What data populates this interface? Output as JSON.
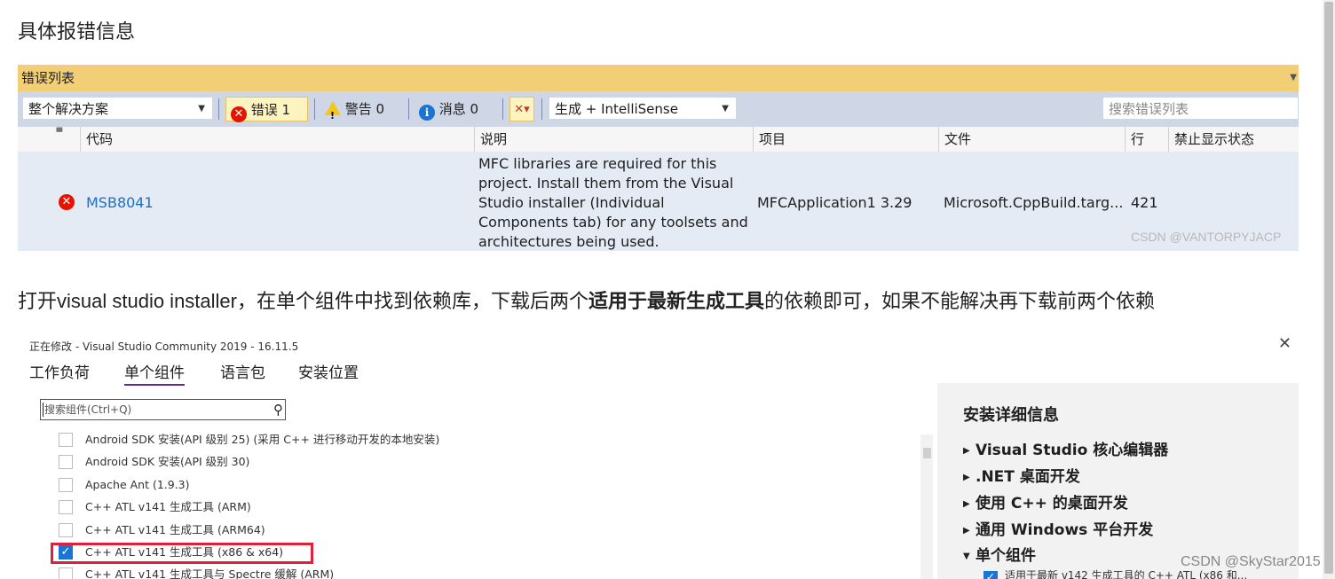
{
  "heading1": "具体报错信息",
  "error_list": {
    "title": "错误列表",
    "scope": "整个解决方案",
    "errors": "错误 1",
    "warnings": "警告 0",
    "messages": "消息 0",
    "build_filter": "生成 + IntelliSense",
    "search_placeholder": "搜索错误列表",
    "columns": [
      "代码",
      "说明",
      "项目",
      "文件",
      "行",
      "禁止显示状态"
    ],
    "row": {
      "code": "MSB8041",
      "description": [
        "MFC libraries are required for this",
        "project. Install them from the Visual",
        "Studio installer (Individual",
        "Components tab) for any toolsets and",
        "architectures being used."
      ],
      "project": "MFCApplication1 3.29",
      "file": "Microsoft.CppBuild.targ...",
      "line": "421"
    },
    "watermark": "CSDN @VANTORPYJACP"
  },
  "paragraph": {
    "pre": "打开visual studio installer，在单个组件中找到依赖库，下载后两个",
    "bold": "适用于最新生成工具",
    "post": "的依赖即可，如果不能解决再下载前两个依赖"
  },
  "installer": {
    "title": "正在修改 - Visual Studio Community 2019 - 16.11.5",
    "close_glyph": "✕",
    "tabs": [
      "工作负荷",
      "单个组件",
      "语言包",
      "安装位置"
    ],
    "search_placeholder": "搜索组件(Ctrl+Q)",
    "components": [
      {
        "label": "Android SDK 安装(API 级别 25) (采用 C++ 进行移动开发的本地安装)",
        "checked": false
      },
      {
        "label": "Android SDK 安装(API 级别 30)",
        "checked": false
      },
      {
        "label": "Apache Ant (1.9.3)",
        "checked": false
      },
      {
        "label": "C++ ATL v141 生成工具 (ARM)",
        "checked": false
      },
      {
        "label": "C++ ATL v141 生成工具 (ARM64)",
        "checked": false
      },
      {
        "label": "C++ ATL v141 生成工具  (x86 & x64)",
        "checked": true
      },
      {
        "label": "C++ ATL v141 生成工具与 Spectre 缓解 (ARM)",
        "checked": false
      }
    ],
    "details": {
      "title": "安装详细信息",
      "items": [
        "Visual Studio 核心编辑器",
        ".NET 桌面开发",
        "使用 C++ 的桌面开发",
        "通用 Windows 平台开发",
        "单个组件"
      ],
      "sub_item": "适用于最新 v142 生成工具的 C++ ATL (x86 和..."
    }
  },
  "watermark_page": "CSDN @SkyStar2015"
}
